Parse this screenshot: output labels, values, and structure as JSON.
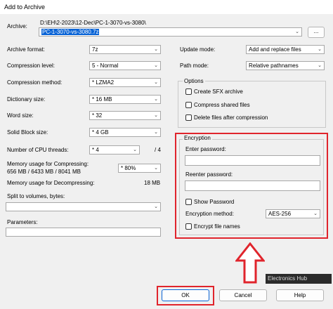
{
  "window": {
    "title": "Add to Archive"
  },
  "archive": {
    "label": "Archive:",
    "path": "D:\\EH\\2-2023\\12-Dec\\PC-1-3070-vs-3080\\",
    "name": "PC-1-3070-vs-3080.7z",
    "browse": "..."
  },
  "left": {
    "format": {
      "label": "Archive format:",
      "value": "7z"
    },
    "level": {
      "label": "Compression level:",
      "value": "5 - Normal"
    },
    "method": {
      "label": "Compression method:",
      "value": "* LZMA2"
    },
    "dict": {
      "label": "Dictionary size:",
      "value": "* 16 MB"
    },
    "word": {
      "label": "Word size:",
      "value": "* 32"
    },
    "solid": {
      "label": "Solid Block size:",
      "value": "* 4 GB"
    },
    "threads": {
      "label": "Number of CPU threads:",
      "value": "* 4",
      "max": "/ 4"
    },
    "mem_comp": {
      "label": "Memory usage for Compressing:",
      "detail": "656 MB / 6433 MB / 8041 MB",
      "value": "* 80%"
    },
    "mem_decomp": {
      "label": "Memory usage for Decompressing:",
      "value": "18 MB"
    },
    "split": {
      "label": "Split to volumes, bytes:",
      "value": ""
    },
    "params": {
      "label": "Parameters:",
      "value": ""
    }
  },
  "right": {
    "update": {
      "label": "Update mode:",
      "value": "Add and replace files"
    },
    "path": {
      "label": "Path mode:",
      "value": "Relative pathnames"
    },
    "options": {
      "title": "Options",
      "sfx": "Create SFX archive",
      "shared": "Compress shared files",
      "delete": "Delete files after compression"
    },
    "encryption": {
      "title": "Encryption",
      "enter": "Enter password:",
      "reenter": "Reenter password:",
      "show": "Show Password",
      "method_label": "Encryption method:",
      "method_value": "AES-256",
      "names": "Encrypt file names"
    }
  },
  "buttons": {
    "ok": "OK",
    "cancel": "Cancel",
    "help": "Help"
  },
  "watermark": "Electronics Hub",
  "colors": {
    "highlight_border": "#e0242c",
    "selection": "#0a64d6"
  }
}
